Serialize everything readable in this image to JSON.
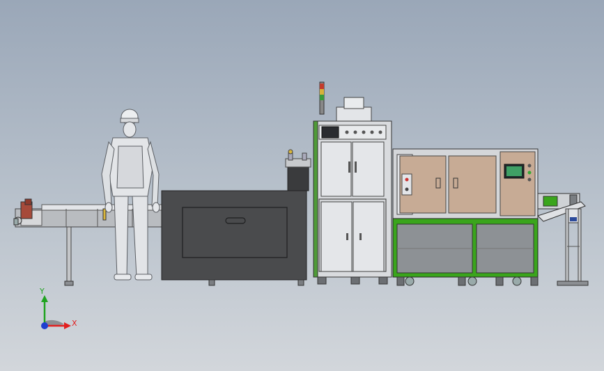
{
  "triad": {
    "x_label": "X",
    "y_label": "Y",
    "x_color": "#e21f1f",
    "y_color": "#1fa31f",
    "z_color": "#1f3fd0"
  },
  "colors": {
    "background_top": "#9aa7b8",
    "background_bottom": "#d2d6db",
    "cabinet_dark": "#4a4b4d",
    "frame_green": "#3aa51c",
    "panel_tan": "#c7ab95",
    "frame_grey": "#8e9297"
  }
}
